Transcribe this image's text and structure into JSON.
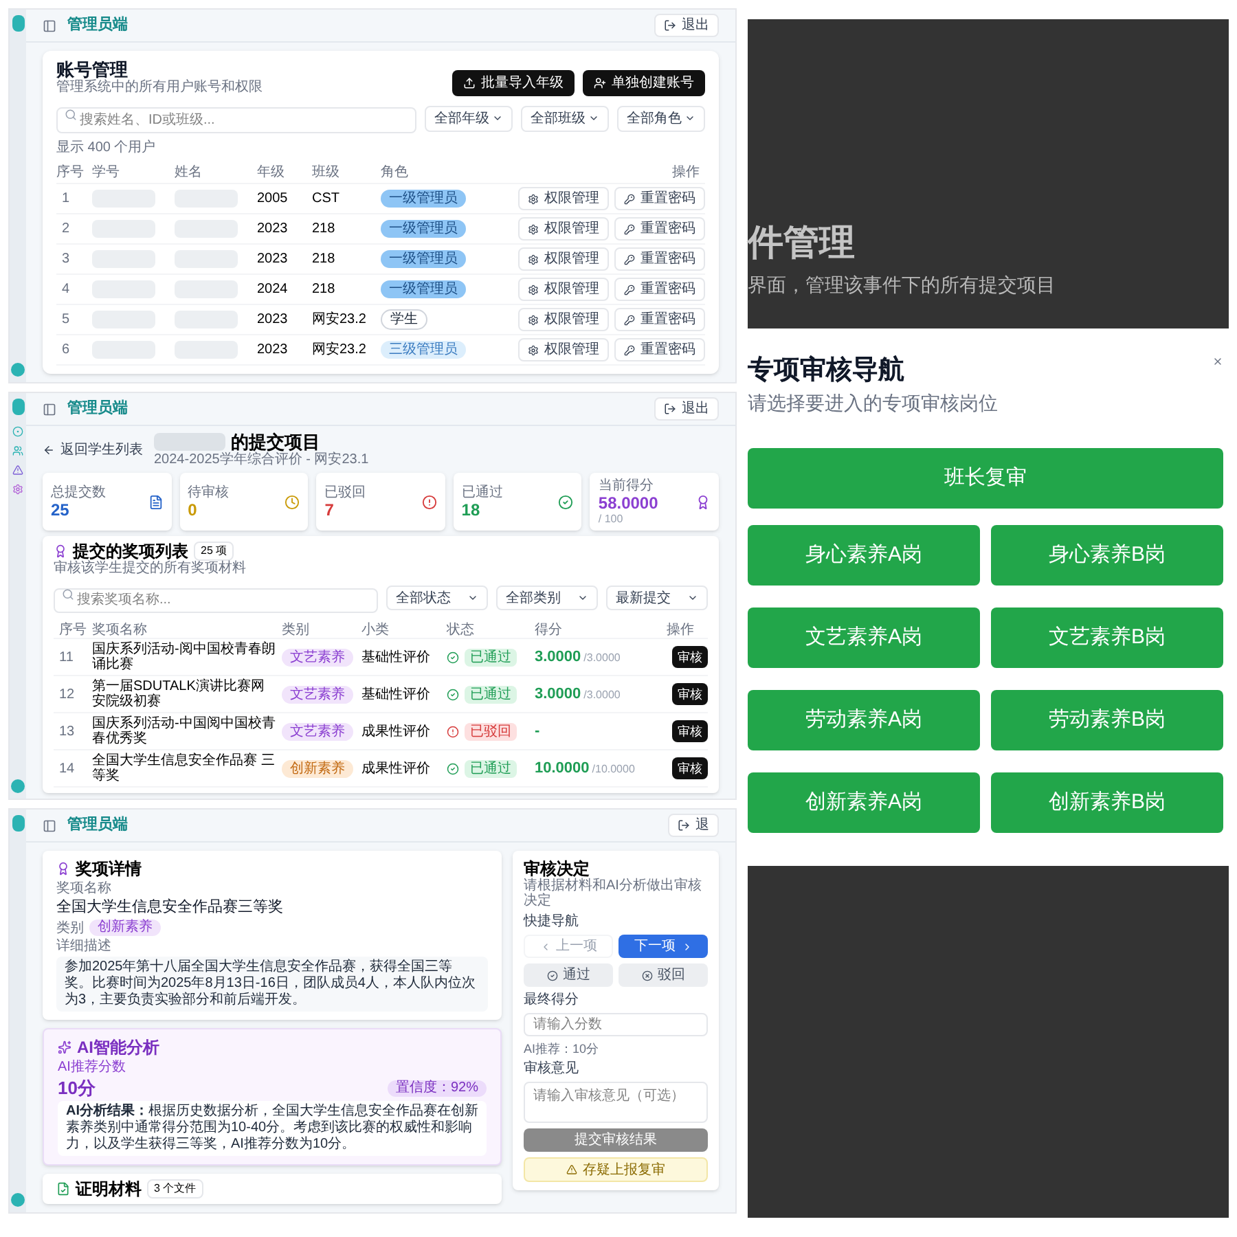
{
  "account_panel": {
    "header": {
      "title": "管理员端",
      "logout": "退出"
    },
    "title": "账号管理",
    "subtitle": "管理系统中的所有用户账号和权限",
    "buttons": [
      {
        "label": "批量导入年级",
        "kind": "import"
      },
      {
        "label": "单独创建账号",
        "kind": "create"
      }
    ],
    "search": {
      "placeholder": "搜索姓名、ID或班级..."
    },
    "filters": [
      "全部年级",
      "全部班级",
      "全部角色"
    ],
    "count": "显示 400 个用户",
    "columns": [
      "序号",
      "学号",
      "姓名",
      "年级",
      "班级",
      "角色",
      "操作"
    ],
    "rows": [
      {
        "index": "1",
        "grade": "2005",
        "class": "CST",
        "role": {
          "label": "一级管理员",
          "kind": "level1"
        },
        "actions": [
          "权限管理",
          "重置密码"
        ]
      },
      {
        "index": "2",
        "grade": "2023",
        "class": "218",
        "role": {
          "label": "一级管理员",
          "kind": "level1"
        },
        "actions": [
          "权限管理",
          "重置密码"
        ]
      },
      {
        "index": "3",
        "grade": "2023",
        "class": "218",
        "role": {
          "label": "一级管理员",
          "kind": "level1"
        },
        "actions": [
          "权限管理",
          "重置密码"
        ]
      },
      {
        "index": "4",
        "grade": "2024",
        "class": "218",
        "role": {
          "label": "一级管理员",
          "kind": "level1"
        },
        "actions": [
          "权限管理",
          "重置密码"
        ]
      },
      {
        "index": "5",
        "grade": "2023",
        "class": "网安23.2",
        "role": {
          "label": "学生",
          "kind": "student"
        },
        "actions": [
          "权限管理",
          "重置密码"
        ]
      },
      {
        "index": "6",
        "grade": "2023",
        "class": "网安23.2",
        "role": {
          "label": "三级管理员",
          "kind": "level3"
        },
        "actions": [
          "权限管理",
          "重置密码"
        ]
      }
    ]
  },
  "submissions_panel": {
    "header": {
      "title": "管理员端",
      "logout": "退出"
    },
    "back": "返回学生列表",
    "title": "的提交项目",
    "subtitle": "2024-2025学年综合评价 - 网安23.1",
    "stats": [
      {
        "label": "总提交数",
        "value": "25",
        "kind": "total"
      },
      {
        "label": "待审核",
        "value": "0",
        "kind": "pending"
      },
      {
        "label": "已驳回",
        "value": "7",
        "kind": "rejected"
      },
      {
        "label": "已通过",
        "value": "18",
        "kind": "approved"
      },
      {
        "label": "当前得分",
        "value": "58.0000",
        "sub": "/ 100",
        "kind": "score"
      }
    ],
    "list": {
      "title": "提交的奖项列表",
      "count": "25 项",
      "subtitle": "审核该学生提交的所有奖项材料",
      "search": {
        "placeholder": "搜索奖项名称..."
      },
      "filters": [
        "全部状态",
        "全部类别",
        "最新提交"
      ],
      "columns": [
        "序号",
        "奖项名称",
        "类别",
        "小类",
        "状态",
        "得分",
        "操作"
      ],
      "rows": [
        {
          "index": "11",
          "name": "国庆系列活动-阅中国校青春朗诵比赛",
          "category": {
            "label": "文艺素养",
            "kind": "arts"
          },
          "subcategory": "基础性评价",
          "status": {
            "label": "已通过",
            "kind": "approved"
          },
          "score": "3.0000",
          "max": "/3.0000",
          "action": "审核"
        },
        {
          "index": "12",
          "name": "第一届SDUTALK演讲比赛网安院级初赛",
          "category": {
            "label": "文艺素养",
            "kind": "arts"
          },
          "subcategory": "基础性评价",
          "status": {
            "label": "已通过",
            "kind": "approved"
          },
          "score": "3.0000",
          "max": "/3.0000",
          "action": "审核"
        },
        {
          "index": "13",
          "name": "国庆系列活动-中国阅中国校青春优秀奖",
          "category": {
            "label": "文艺素养",
            "kind": "arts"
          },
          "subcategory": "成果性评价",
          "status": {
            "label": "已驳回",
            "kind": "rejected"
          },
          "score": "-",
          "action": "审核"
        },
        {
          "index": "14",
          "name": "全国大学生信息安全作品赛 三等奖",
          "category": {
            "label": "创新素养",
            "kind": "innovation"
          },
          "subcategory": "成果性评价",
          "status": {
            "label": "已通过",
            "kind": "approved"
          },
          "score": "10.0000",
          "max": "/10.0000",
          "action": "审核"
        }
      ]
    }
  },
  "review_panel": {
    "header": {
      "title": "管理员端",
      "logout": "退"
    },
    "detail": {
      "title": "奖项详情",
      "name_label": "奖项名称",
      "name": "全国大学生信息安全作品赛三等奖",
      "category_label": "类别",
      "category": "创新素养",
      "desc_label": "详细描述",
      "desc": "参加2025年第十八届全国大学生信息安全作品赛，获得全国三等奖。比赛时间为2025年8月13日-16日，团队成员4人，本人队内位次为3，主要负责实验部分和前后端开发。"
    },
    "ai": {
      "title": "AI智能分析",
      "score_label": "AI推荐分数",
      "score": "10分",
      "confidence": "置信度：92%",
      "result": "**AI分析结果：**根据历史数据分析，全国大学生信息安全作品赛在创新素养类别中通常得分范围为10-40分。考虑到该比赛的权威性和影响力，以及学生获得三等奖，AI推荐分数为10分。"
    },
    "evidence": {
      "title": "证明材料",
      "count": "3 个文件"
    },
    "decision": {
      "title": "审核决定",
      "subtitle": "请根据材料和AI分析做出审核决定",
      "nav_label": "快捷导航",
      "prev": "上一项",
      "next": "下一项",
      "approve": "通过",
      "reject": "驳回",
      "score_label": "最终得分",
      "score_placeholder": "请输入分数",
      "ai_hint": "AI推荐：10分",
      "comment_label": "审核意见",
      "comment_placeholder": "请输入审核意见（可选）",
      "submit": {
        "label": "提交审核结果",
        "disabled": true
      },
      "escalate": "存疑上报复审"
    }
  },
  "nav_panel": {
    "backdrop": {
      "title": "件管理",
      "subtitle": "界面，管理该事件下的所有提交项目"
    },
    "dialog": {
      "title": "专项审核导航",
      "subtitle": "请选择要进入的专项审核岗位",
      "lead": "班长复审",
      "posts": [
        "身心素养A岗",
        "身心素养B岗",
        "文艺素养A岗",
        "文艺素养B岗",
        "劳动素养A岗",
        "劳动素养B岗",
        "创新素养A岗",
        "创新素养B岗"
      ]
    }
  }
}
